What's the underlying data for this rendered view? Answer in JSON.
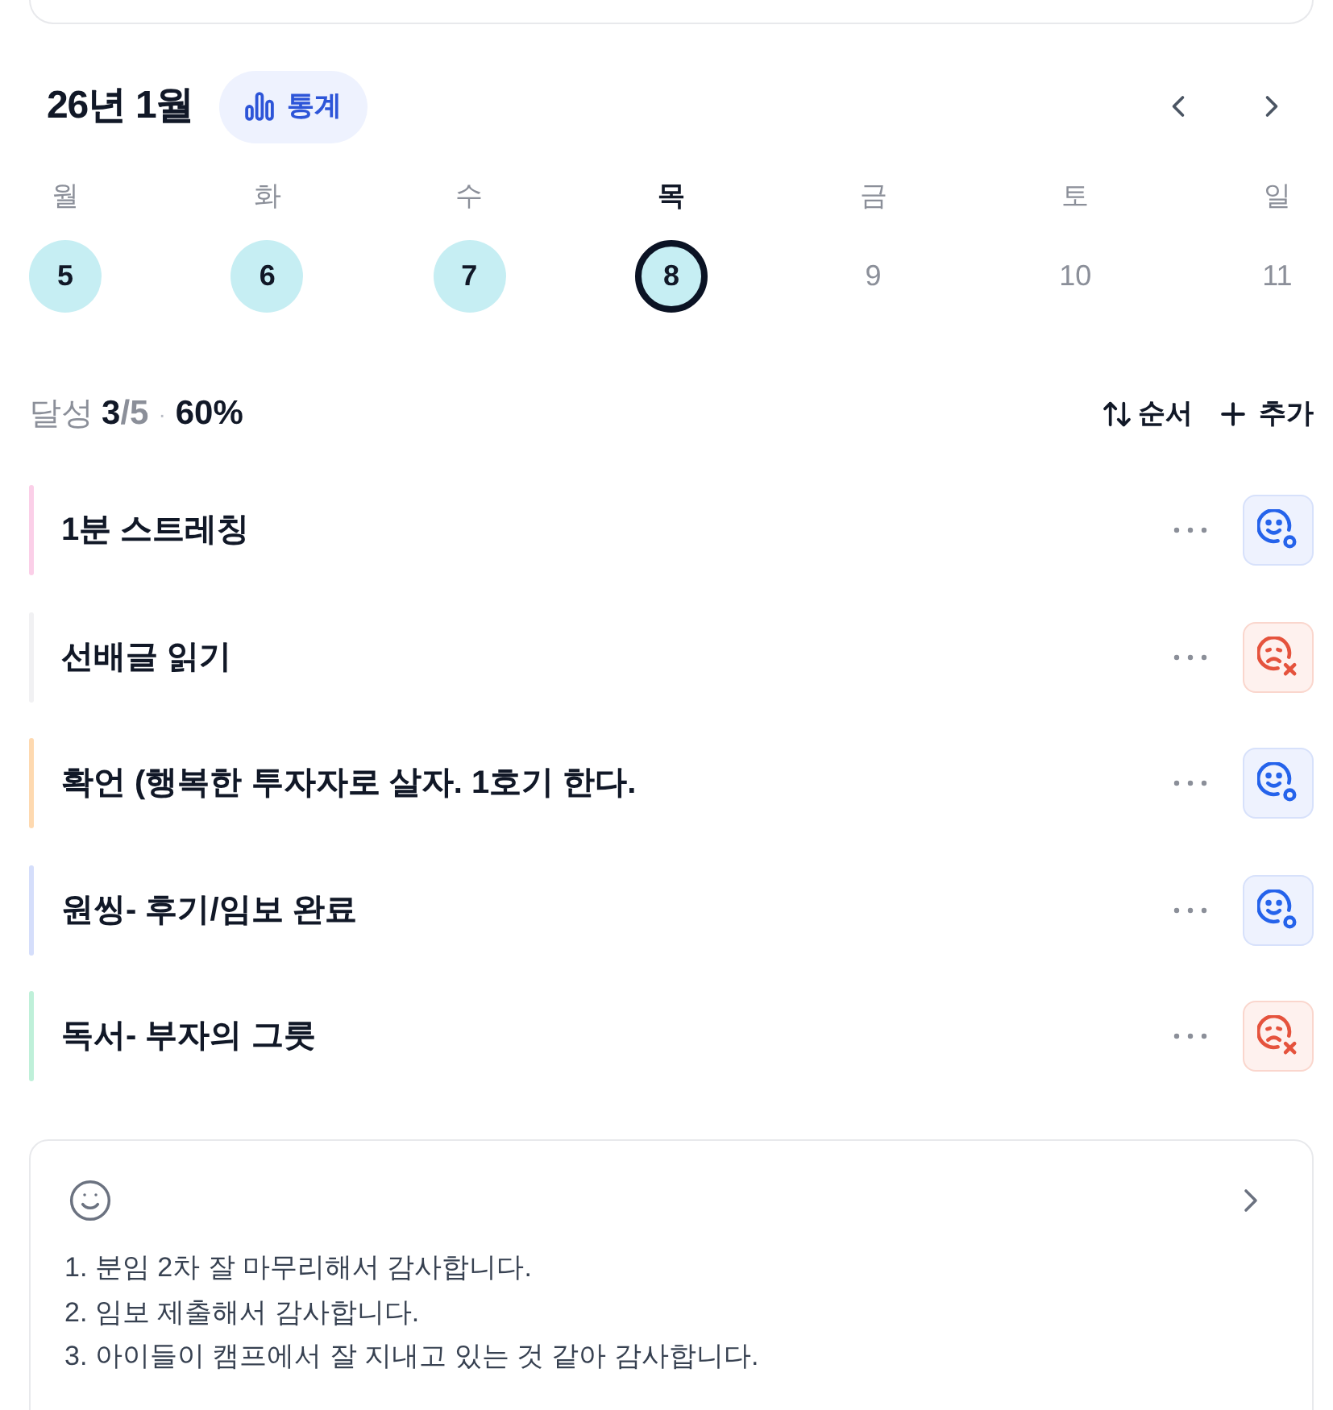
{
  "calendar": {
    "title": "26년 1월",
    "stats_button": {
      "label": "통계"
    },
    "days": [
      {
        "weekday": "월",
        "date": "5",
        "done": true,
        "selected": false
      },
      {
        "weekday": "화",
        "date": "6",
        "done": true,
        "selected": false
      },
      {
        "weekday": "수",
        "date": "7",
        "done": true,
        "selected": false
      },
      {
        "weekday": "목",
        "date": "8",
        "done": true,
        "selected": true
      },
      {
        "weekday": "금",
        "date": "9",
        "done": false,
        "selected": false
      },
      {
        "weekday": "토",
        "date": "10",
        "done": false,
        "selected": false
      },
      {
        "weekday": "일",
        "date": "11",
        "done": false,
        "selected": false
      }
    ]
  },
  "summary": {
    "label": "달성",
    "achieved": "3",
    "total": "/5",
    "separator": "·",
    "percent": "60%"
  },
  "toolbar": {
    "sort_label": "순서",
    "add_label": "추가"
  },
  "habits": [
    {
      "title": "1분 스트레칭",
      "color": "#fbcfe8",
      "done": true
    },
    {
      "title": "선배글 읽기",
      "color": "#f1f1f3",
      "done": false
    },
    {
      "title": "확언 (행복한 투자자로 살자. 1호기 한다.",
      "color": "#fed9b0",
      "done": true
    },
    {
      "title": "원씽- 후기/임보 완료",
      "color": "#d5defb",
      "done": true
    },
    {
      "title": "독서- 부자의 그릇",
      "color": "#bff0d9",
      "done": false
    }
  ],
  "gratitude": {
    "lines": [
      "1. 분임 2차 잘 마무리해서 감사합니다.",
      "2. 임보 제출해서 감사합니다.",
      "3. 아이들이 캠프에서 잘 지내고 있는 것 같아 감사합니다."
    ]
  }
}
